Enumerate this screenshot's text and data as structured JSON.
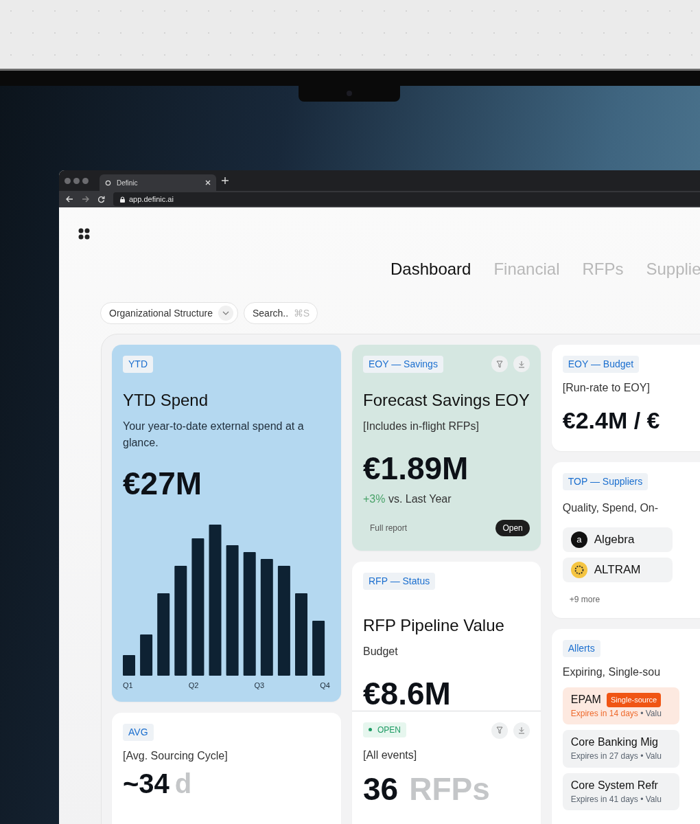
{
  "browser": {
    "tab_title": "Definic",
    "url": "app.definic.ai"
  },
  "nav": {
    "tabs": [
      {
        "label": "Dashboard",
        "selected": true
      },
      {
        "label": "Financial",
        "selected": false
      },
      {
        "label": "RFPs",
        "selected": false
      },
      {
        "label": "Supplie",
        "selected": false
      }
    ]
  },
  "filters": {
    "dropdown": "Organizational Structure",
    "search": {
      "placeholder": "Search..",
      "shortcut": "⌘S"
    }
  },
  "ytd_card": {
    "tag": "YTD",
    "title": "YTD Spend",
    "subtitle": "Your year-to-date external spend at a glance.",
    "value": "€27M",
    "axis_labels": [
      "Q1",
      "Q2",
      "Q3",
      "Q4"
    ]
  },
  "avg_card": {
    "tag": "AVG",
    "subtitle": "[Avg. Sourcing Cycle]",
    "value": "~34",
    "unit": "d"
  },
  "savings_card": {
    "tag": "EOY — Savings",
    "title": "Forecast Savings EOY",
    "subtitle": "[Includes in-flight RFPs]",
    "value": "€1.89M",
    "delta": "+3%",
    "delta_text": "vs. Last Year",
    "link": "Full report",
    "button": "Open"
  },
  "rfp_card": {
    "tag": "RFP — Status",
    "title": "RFP Pipeline Value",
    "subtitle": "Budget",
    "value": "€8.6M",
    "status": "OPEN",
    "filter": "[All events]",
    "count": "36",
    "unit": "RFPs"
  },
  "budget_card": {
    "tag": "EOY — Budget",
    "subtitle": "[Run-rate to EOY]",
    "value": "€2.4M / €"
  },
  "suppliers_card": {
    "tag": "TOP — Suppliers",
    "subtitle": "Quality, Spend, On-",
    "suppliers": [
      {
        "name": "Algebra",
        "kind": "letter",
        "logo_text": "a"
      },
      {
        "name": "ALTRAM",
        "kind": "ring"
      }
    ],
    "more": "+9 more"
  },
  "alerts_card": {
    "tag": "Allerts",
    "subtitle": "Expiring, Single-sou",
    "alerts": [
      {
        "title": "EPAM",
        "badge": "Single-source",
        "expires": "Expires in 14 days",
        "rest": "• Valu",
        "urgent": true
      },
      {
        "title": "Core Banking Mig",
        "expires": "Expires in 27 days",
        "rest": "• Valu",
        "urgent": false
      },
      {
        "title": "Core System Refr",
        "expires": "Expires in 41 days",
        "rest": "• Valu",
        "urgent": false
      }
    ]
  }
}
